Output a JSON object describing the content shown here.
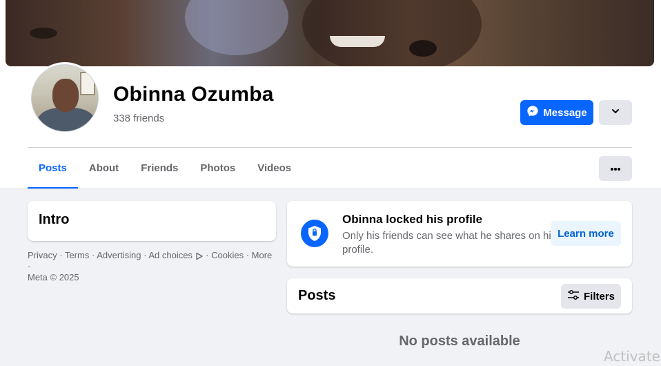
{
  "profile": {
    "name": "Obinna Ozumba",
    "friends": "338 friends"
  },
  "actions": {
    "message_label": "Message"
  },
  "tabs": [
    {
      "label": "Posts",
      "active": true
    },
    {
      "label": "About",
      "active": false
    },
    {
      "label": "Friends",
      "active": false
    },
    {
      "label": "Photos",
      "active": false
    },
    {
      "label": "Videos",
      "active": false
    }
  ],
  "intro": {
    "title": "Intro"
  },
  "footer": {
    "privacy": "Privacy",
    "terms": "Terms",
    "advertising": "Advertising",
    "ad_choices": "Ad choices",
    "cookies": "Cookies",
    "more": "More",
    "meta": "Meta © 2025"
  },
  "locked": {
    "title": "Obinna locked his profile",
    "description": "Only his friends can see what he shares on his profile.",
    "learn_more": "Learn more"
  },
  "posts": {
    "title": "Posts",
    "filters_label": "Filters",
    "empty": "No posts available"
  },
  "watermark": {
    "text": "Activate W"
  },
  "colors": {
    "accent": "#0866ff",
    "secondary_button": "#e4e6eb",
    "background": "#f0f2f5"
  },
  "icons": [
    "messenger-icon",
    "chevron-down-icon",
    "more-dots-icon",
    "ad-choices-icon",
    "shield-lock-icon",
    "filters-icon"
  ]
}
